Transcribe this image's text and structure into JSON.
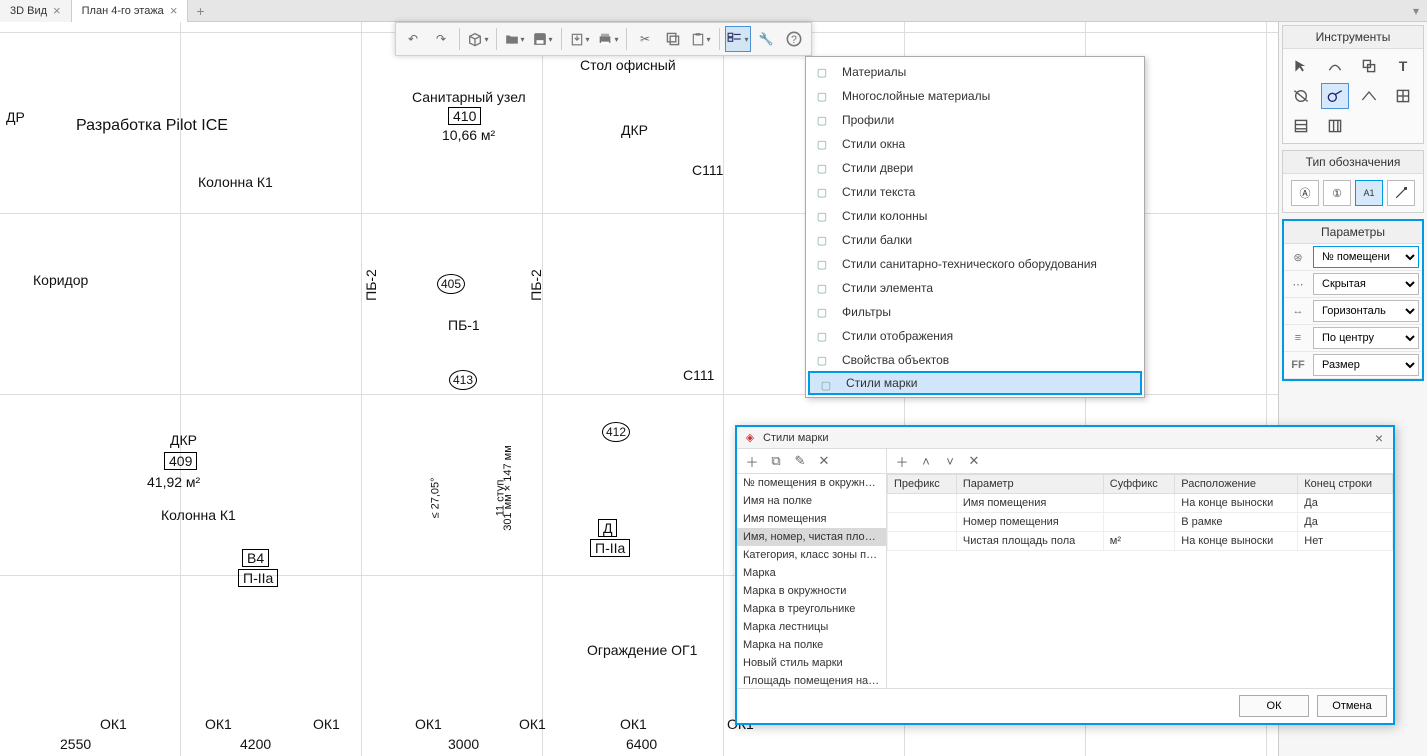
{
  "tabs": [
    {
      "label": "3D Вид",
      "active": false
    },
    {
      "label": "План 4-го этажа",
      "active": true
    }
  ],
  "drawing_labels": {
    "pilot": "Разработка Pilot ICE",
    "column_k1_top": "Колонна К1",
    "column_k1_bot": "Колонна К1",
    "dr": "ДР",
    "dkr": "ДКР",
    "sanitary": "Санитарный узел",
    "sanitary_num": "410",
    "sanitary_area": "10,66 м²",
    "corridor": "Коридор",
    "stol": "Стол офисный",
    "c111a": "С111",
    "c111b": "С111",
    "dkr2": "ДКР",
    "dkr2_num": "409",
    "dkr2_area": "41,92 м²",
    "b4": "В4",
    "p2a": "П-IIа",
    "d": "Д",
    "p2a2": "П-IIа",
    "pb1": "ПБ-1",
    "pb2a": "ПБ-2",
    "pb2b": "ПБ-2",
    "num405": "405",
    "num413": "413",
    "num412": "412",
    "fence": "Ограждение ОГ1",
    "steps11": "11 ступ",
    "dim301": "301 мм × 147 мм",
    "dim2705": "≤ 27,05°",
    "ok1": "ОК1",
    "d2550": "2550",
    "d4200": "4200",
    "d3000": "3000",
    "d6400": "6400"
  },
  "menu": {
    "items": [
      "Материалы",
      "Многослойные материалы",
      "Профили",
      "Стили окна",
      "Стили двери",
      "Стили текста",
      "Стили колонны",
      "Стили балки",
      "Стили санитарно-технического оборудования",
      "Стили элемента",
      "Фильтры",
      "Стили отображения",
      "Свойства объектов",
      "Стили марки"
    ],
    "highlighted_index": 13
  },
  "panels": {
    "instruments_title": "Инструменты",
    "type_title": "Тип обозначения",
    "params_title": "Параметры",
    "param_rows": [
      {
        "value": "№ помещени"
      },
      {
        "value": "Скрытая"
      },
      {
        "value": "Горизонталь"
      },
      {
        "value": "По центру"
      },
      {
        "value": "Размер"
      }
    ]
  },
  "dialog": {
    "title": "Стили марки",
    "styles": [
      "№ помещения в окружности",
      "Имя на полке",
      "Имя помещения",
      "Имя, номер, чистая площадь по",
      "Категория, класс зоны помещен",
      "Марка",
      "Марка в окружности",
      "Марка в треугольнике",
      "Марка лестницы",
      "Марка на полке",
      "Новый стиль марки",
      "Площадь помещения на полке"
    ],
    "selected_style_index": 3,
    "columns": [
      "Префикс",
      "Параметр",
      "Суффикс",
      "Расположение",
      "Конец строки"
    ],
    "rows": [
      {
        "prefix": "",
        "param": "Имя помещения",
        "suffix": "",
        "pos": "На конце выноски",
        "eol": "Да"
      },
      {
        "prefix": "",
        "param": "Номер помещения",
        "suffix": "",
        "pos": "В рамке",
        "eol": "Да"
      },
      {
        "prefix": "",
        "param": "Чистая площадь пола",
        "suffix": "м²",
        "pos": "На конце выноски",
        "eol": "Нет"
      }
    ],
    "ok": "ОК",
    "cancel": "Отмена"
  }
}
